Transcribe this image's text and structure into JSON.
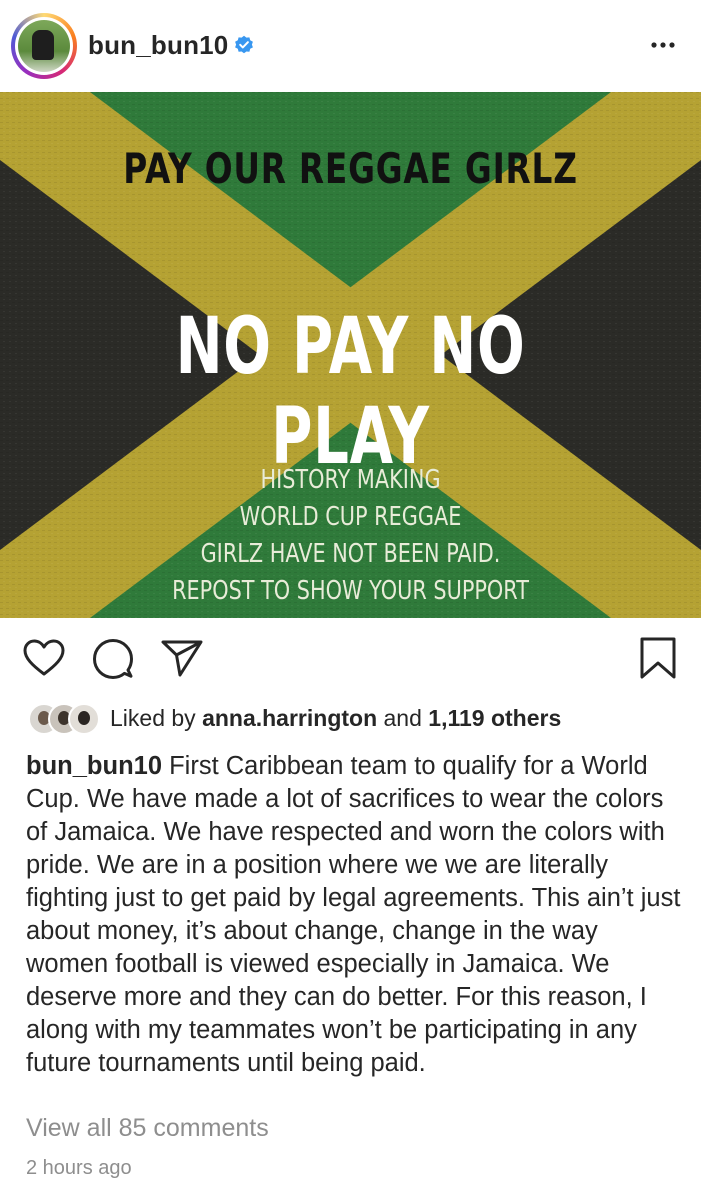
{
  "post": {
    "username": "bun_bun10",
    "verified": true,
    "image": {
      "headline": "PAY OUR REGGAE GIRLZ",
      "slogan": "NO PAY NO PLAY",
      "subtext": [
        "HISTORY MAKING",
        "WORLD CUP REGGAE",
        "GIRLZ HAVE NOT BEEN PAID.",
        "REPOST TO SHOW YOUR SUPPORT"
      ],
      "colors": {
        "green": "#2f7a3a",
        "gold": "#b5a233",
        "black": "#2b2b27"
      }
    },
    "actions": {
      "like_icon": "heart-icon",
      "comment_icon": "comment-icon",
      "share_icon": "send-icon",
      "save_icon": "bookmark-icon"
    },
    "likes": {
      "prefix": "Liked by",
      "user": "anna.harrington",
      "and": "and",
      "others": "1,119 others"
    },
    "caption": {
      "user": "bun_bun10",
      "text": "First Caribbean team to qualify for a World Cup. We have made a lot of sacrifices to wear the colors of Jamaica. We have respected and worn the colors with pride. We are in a position where we we are literally fighting just to get paid by legal agreements. This ain’t just about money, it’s about change, change in the way women football is viewed especially in Jamaica. We deserve more and they can do better. For this reason, I along with my teammates won’t be participating in any future tournaments until being paid."
    },
    "view_comments": "View all 85 comments",
    "timestamp": "2 hours ago"
  }
}
